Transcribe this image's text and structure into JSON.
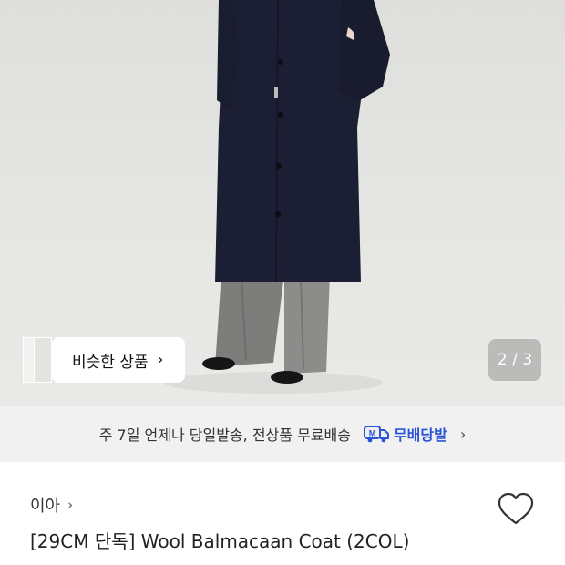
{
  "hero": {
    "similar_button": {
      "label": "비슷한 상품",
      "chevron": "›"
    },
    "image_counter": "2 / 3"
  },
  "delivery_banner": {
    "text": "주 7일 언제나 당일발송, 전상품 무료배송",
    "badge_icon": "delivery-truck-icon",
    "badge_label": "무배당발",
    "badge_color": "#2a55d9",
    "chevron": "›"
  },
  "product": {
    "store_name": "이아",
    "store_chevron": "›",
    "title": "[29CM 단독] Wool Balmacaan Coat (2COL)",
    "wishlist_icon": "heart-outline-icon"
  }
}
